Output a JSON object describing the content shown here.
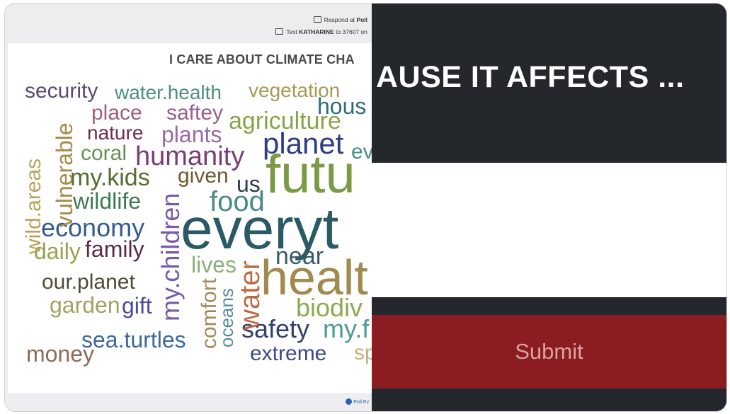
{
  "left_panel": {
    "respond_prefix": "Respond at ",
    "respond_site": "Poll",
    "text_prefix": "Text ",
    "text_keyword": "KATHARINE",
    "text_middle": " to 37607 on",
    "title": "I CARE ABOUT CLIMATE CHA",
    "footer_logo": "Poll Ev",
    "words": [
      {
        "text": "security",
        "color": "#5b4a72"
      },
      {
        "text": "water.health",
        "color": "#4e8f7d"
      },
      {
        "text": "vegetation",
        "color": "#a59a55"
      },
      {
        "text": "hous",
        "color": "#2f6e78"
      },
      {
        "text": "place",
        "color": "#a35e7e"
      },
      {
        "text": "saftey",
        "color": "#9a5d8c"
      },
      {
        "text": "agriculture",
        "color": "#8aa34a"
      },
      {
        "text": "nature",
        "color": "#6b2f46"
      },
      {
        "text": "plants",
        "color": "#9a6aa8"
      },
      {
        "text": "planet",
        "color": "#2f3c86"
      },
      {
        "text": "ev",
        "color": "#4a8f88"
      },
      {
        "text": "coral",
        "color": "#679152"
      },
      {
        "text": "humanity",
        "color": "#7a3e76"
      },
      {
        "text": "futu",
        "color": "#7a9a45"
      },
      {
        "text": "my.kids",
        "color": "#566c2f"
      },
      {
        "text": "given",
        "color": "#6d5a2e"
      },
      {
        "text": "us",
        "color": "#2c3e4e"
      },
      {
        "text": "wildlife",
        "color": "#3c7a52"
      },
      {
        "text": "food",
        "color": "#4b8a86"
      },
      {
        "text": "economy",
        "color": "#365a8e"
      },
      {
        "text": "everyt",
        "color": "#2a5a66"
      },
      {
        "text": "daily",
        "color": "#98a14b"
      },
      {
        "text": "family",
        "color": "#5a2a4e"
      },
      {
        "text": "near",
        "color": "#3b5a6a"
      },
      {
        "text": "healt",
        "color": "#a08a4e"
      },
      {
        "text": "lives",
        "color": "#8ab078"
      },
      {
        "text": "our.planet",
        "color": "#4e4a36"
      },
      {
        "text": "garden",
        "color": "#a5a063"
      },
      {
        "text": "gift",
        "color": "#4a4a9a"
      },
      {
        "text": "biodiv",
        "color": "#8aaa4e"
      },
      {
        "text": "safety",
        "color": "#2f3f6e"
      },
      {
        "text": "my.f",
        "color": "#4e9a9a"
      },
      {
        "text": "sea.turtles",
        "color": "#3d6a9c"
      },
      {
        "text": "money",
        "color": "#8a6a5a"
      },
      {
        "text": "extreme",
        "color": "#3c4a8e"
      },
      {
        "text": "sp",
        "color": "#c5b27a"
      },
      {
        "text": "vulnerable",
        "color": "#a48a4a"
      },
      {
        "text": "wild.areas",
        "color": "#b9a35c"
      },
      {
        "text": "my.children",
        "color": "#7a5aa8"
      },
      {
        "text": "comfort",
        "color": "#a08a5a"
      },
      {
        "text": "oceans",
        "color": "#5a8a9a"
      },
      {
        "text": "water",
        "color": "#c06a44"
      }
    ]
  },
  "right_panel": {
    "question": "AUSE IT AFFECTS ...",
    "answer_value": "",
    "submit_label": "Submit"
  }
}
